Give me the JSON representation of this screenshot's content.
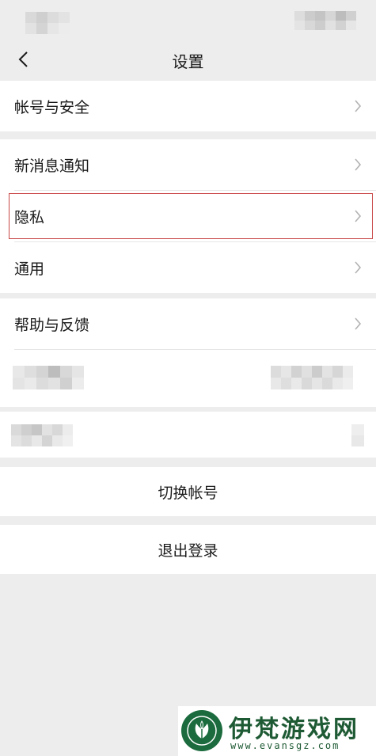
{
  "header": {
    "title": "设置"
  },
  "groups": {
    "account": {
      "label": "帐号与安全"
    },
    "notify": {
      "label": "新消息通知"
    },
    "privacy": {
      "label": "隐私"
    },
    "general": {
      "label": "通用"
    },
    "help": {
      "label": "帮助与反馈"
    }
  },
  "actions": {
    "switch_account": "切换帐号",
    "logout": "退出登录"
  },
  "icons": {
    "back": "chevron-left-icon",
    "chevron": "chevron-right-icon",
    "logo": "tulip-logo"
  },
  "colors": {
    "background": "#ededed",
    "highlight": "#c94848",
    "watermark": "#1e5a34"
  },
  "watermark": {
    "title": "伊梵游戏网",
    "url": "www.evansgz.com"
  }
}
